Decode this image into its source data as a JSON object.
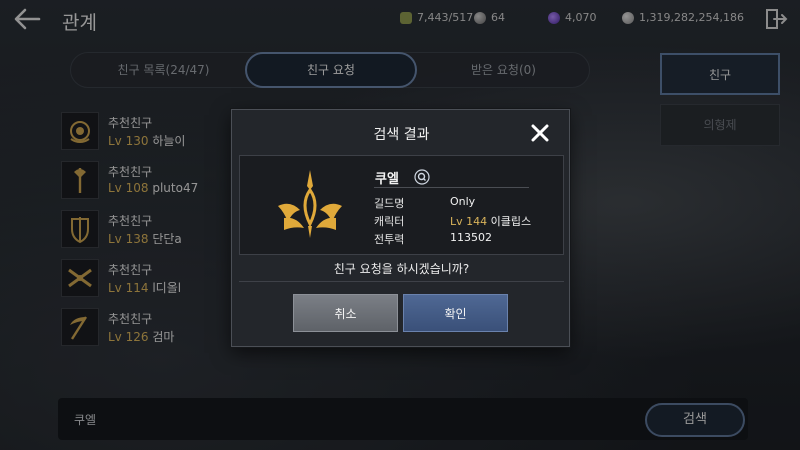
{
  "header": {
    "title": "관계",
    "resources": [
      {
        "name": "energy",
        "value": "7,443/517",
        "color": "#9aa35a"
      },
      {
        "name": "silver-orb",
        "value": "64",
        "color": "#8a8a8a"
      },
      {
        "name": "purple-gem",
        "value": "4,070",
        "color": "#7b4fd1"
      },
      {
        "name": "coin",
        "value": "1,319,282,254,186",
        "color": "#b0b0b0"
      }
    ]
  },
  "tabs": [
    {
      "label": "친구 목록(24/47)",
      "active": false
    },
    {
      "label": "친구 요청",
      "active": true
    },
    {
      "label": "받은 요청(0)",
      "active": false
    }
  ],
  "side": {
    "friend_label": "친구",
    "relation_label": "의형제"
  },
  "friends": [
    {
      "title": "추천친구",
      "lv": "Lv 130",
      "name": "하늘이",
      "icon": "rose-emblem-icon"
    },
    {
      "title": "추천친구",
      "lv": "Lv 108",
      "name": "pluto47",
      "icon": "axe-emblem-icon"
    },
    {
      "title": "추천친구",
      "lv": "Lv 138",
      "name": "단단a",
      "icon": "shield-sword-emblem-icon"
    },
    {
      "title": "추천친구",
      "lv": "Lv 114",
      "name": "l디올l",
      "icon": "crossed-guns-emblem-icon"
    },
    {
      "title": "추천친구",
      "lv": "Lv 126",
      "name": "검마",
      "icon": "scythe-emblem-icon"
    }
  ],
  "search": {
    "value": "쿠엘",
    "button": "검색"
  },
  "modal": {
    "title": "검색 결과",
    "username": "쿠엘",
    "guild_label": "길드명",
    "guild_value": "Only",
    "char_label": "캐릭터",
    "char_lv": "Lv 144",
    "char_class": "이클립스",
    "power_label": "전투력",
    "power_value": "113502",
    "question": "친구 요청을 하시겠습니까?",
    "cancel": "취소",
    "ok": "확인"
  },
  "colors": {
    "accent_blue": "#5f7aa0",
    "level_gold": "#d9b35a"
  }
}
